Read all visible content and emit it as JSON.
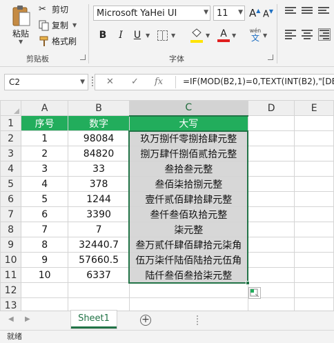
{
  "ribbon": {
    "clipboard": {
      "paste_label": "粘贴",
      "cut_label": "剪切",
      "copy_label": "复制",
      "format_painter_label": "格式刷",
      "group_label": "剪贴板"
    },
    "font": {
      "font_name": "Microsoft YaHei UI",
      "font_size": "11",
      "increase_font": "A",
      "decrease_font": "A",
      "bold": "B",
      "italic": "I",
      "underline": "U",
      "font_color_letter": "A",
      "phonetic_label": "wén",
      "group_label": "字体"
    }
  },
  "formula_bar": {
    "name_box": "C2",
    "fx": "fx",
    "formula": "=IF(MOD(B2,1)=0,TEXT(INT(B2),\"[DB"
  },
  "grid": {
    "columns": [
      "A",
      "B",
      "C",
      "D",
      "E"
    ],
    "selected_column": "C",
    "header": {
      "A": "序号",
      "B": "数字",
      "C": "大写"
    },
    "rows": [
      {
        "row": "2",
        "a": "1",
        "b": "98084",
        "c": "玖万捌仟零捌拾肆元整"
      },
      {
        "row": "3",
        "a": "2",
        "b": "84820",
        "c": "捌万肆仟捌佰贰拾元整"
      },
      {
        "row": "4",
        "a": "3",
        "b": "33",
        "c": "叁拾叁元整"
      },
      {
        "row": "5",
        "a": "4",
        "b": "378",
        "c": "叁佰柒拾捌元整"
      },
      {
        "row": "6",
        "a": "5",
        "b": "1244",
        "c": "壹仟贰佰肆拾肆元整"
      },
      {
        "row": "7",
        "a": "6",
        "b": "3390",
        "c": "叁仟叁佰玖拾元整"
      },
      {
        "row": "8",
        "a": "7",
        "b": "7",
        "c": "柒元整"
      },
      {
        "row": "9",
        "a": "8",
        "b": "32440.7",
        "c": "叁万贰仟肆佰肆拾元柒角"
      },
      {
        "row": "10",
        "a": "9",
        "b": "57660.5",
        "c": "伍万柒仟陆佰陆拾元伍角"
      },
      {
        "row": "11",
        "a": "10",
        "b": "6337",
        "c": "陆仟叁佰叁拾柒元整"
      }
    ],
    "empty_rows": [
      "12",
      "13"
    ]
  },
  "tabs": {
    "sheet1": "Sheet1",
    "add": "+"
  },
  "status": {
    "ready": "就绪"
  }
}
